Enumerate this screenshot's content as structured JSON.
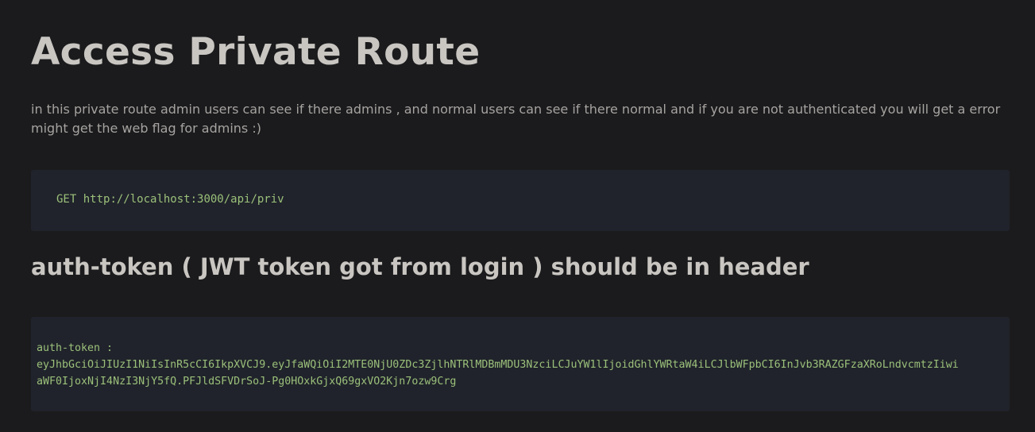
{
  "page": {
    "title": "Access Private Route",
    "description": "in this private route admin users can see if there admins , and normal users can see if there normal and if you are not authenticated you will get a error might get the web flag for admins :)",
    "request": {
      "method": "GET",
      "url": "http://localhost:3000/api/priv"
    },
    "header_heading": "auth-token ( JWT token got from login ) should be in header",
    "token_block": {
      "label": "auth-token :",
      "line1": "eyJhbGciOiJIUzI1NiIsInR5cCI6IkpXVCJ9.eyJfaWQiOiI2MTE0NjU0ZDc3ZjlhNTRlMDBmMDU3NzciLCJuYW1lIjoidGhlYWRtaW4iLCJlbWFpbCI6InJvb3RAZGFzaXRoLndvcmtzIiwi",
      "line2": "aWF0IjoxNjI4NzI3NjY5fQ.PFJldSFVDrSoJ-Pg0HOxkGjxQ69gxVO2Kjn7ozw9Crg"
    }
  },
  "colors": {
    "background": "#1b1b1d",
    "code_background": "#20232b",
    "code_text": "#9bc07a",
    "heading_text": "#c9c6c2",
    "body_text": "#a6a3a0"
  }
}
